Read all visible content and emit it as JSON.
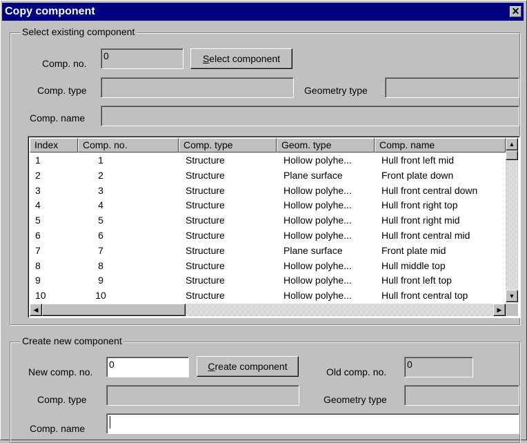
{
  "window": {
    "title": "Copy component",
    "close_glyph": "✕"
  },
  "select_group": {
    "legend": "Select existing component",
    "comp_no_label": "Comp. no.",
    "comp_no_value": "0",
    "select_button": {
      "mnemonic": "S",
      "rest": "elect component"
    },
    "comp_type_label": "Comp. type",
    "comp_type_value": "",
    "geometry_type_label": "Geometry type",
    "geometry_type_value": "",
    "comp_name_label": "Comp. name",
    "comp_name_value": ""
  },
  "table": {
    "columns": [
      "Index",
      "Comp. no.",
      "Comp. type",
      "Geom. type",
      "Comp. name"
    ],
    "rows": [
      [
        "1",
        "1",
        "Structure",
        "Hollow polyhe...",
        "Hull front left mid"
      ],
      [
        "2",
        "2",
        "Structure",
        "Plane surface",
        "Front plate down"
      ],
      [
        "3",
        "3",
        "Structure",
        "Hollow polyhe...",
        "Hull front central down"
      ],
      [
        "4",
        "4",
        "Structure",
        "Hollow polyhe...",
        "Hull front right top"
      ],
      [
        "5",
        "5",
        "Structure",
        "Hollow polyhe...",
        "Hull front right mid"
      ],
      [
        "6",
        "6",
        "Structure",
        "Hollow polyhe...",
        "Hull front central mid"
      ],
      [
        "7",
        "7",
        "Structure",
        "Plane surface",
        "Front plate mid"
      ],
      [
        "8",
        "8",
        "Structure",
        "Hollow polyhe...",
        "Hull middle top"
      ],
      [
        "9",
        "9",
        "Structure",
        "Hollow polyhe...",
        "Hull front left top"
      ],
      [
        "10",
        "10",
        "Structure",
        "Hollow polyhe...",
        "Hull front central top"
      ]
    ],
    "icons": {
      "up": "▲",
      "down": "▼",
      "left": "◀",
      "right": "▶"
    }
  },
  "create_group": {
    "legend": "Create new component",
    "new_comp_no_label": "New comp. no.",
    "new_comp_no_value": "0",
    "create_button": {
      "mnemonic": "C",
      "rest": "reate component"
    },
    "old_comp_no_label": "Old comp. no.",
    "old_comp_no_value": "0",
    "comp_type_label": "Comp. type",
    "comp_type_value": "",
    "geometry_type_label": "Geometry type",
    "geometry_type_value": "",
    "comp_name_label": "Comp. name",
    "comp_name_value": ""
  }
}
